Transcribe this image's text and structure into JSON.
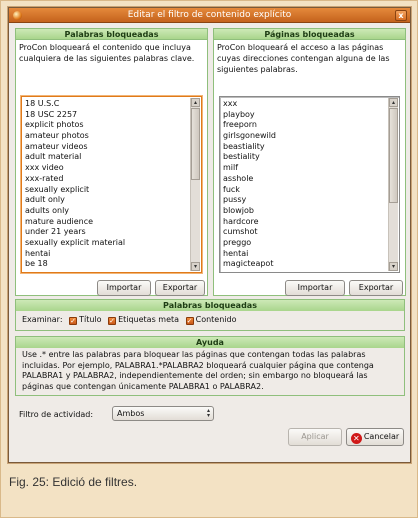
{
  "window": {
    "title": "Editar el filtro de contenido explícito",
    "close_glyph": "x"
  },
  "left_panel": {
    "header": "Palabras bloqueadas",
    "description": "ProCon bloqueará el contenido que incluya cualquiera de las siguientes palabras clave.",
    "items": [
      "18 U.S.C",
      "18 USC 2257",
      "explicit photos",
      "amateur photos",
      "amateur videos",
      "adult material",
      "xxx video",
      "xxx-rated",
      "sexually explicit",
      "adult only",
      "adults only",
      "mature audience",
      "under 21 years",
      "sexually explicit material",
      "hentai",
      "be 18"
    ],
    "import_label": "Importar",
    "export_label": "Exportar"
  },
  "right_panel": {
    "header": "Páginas bloqueadas",
    "description": "ProCon bloqueará el acceso a las páginas cuyas direcciones contengan alguna de las siguientes palabras.",
    "items": [
      "xxx",
      "playboy",
      "freeporn",
      "girlsgonewild",
      "beastiality",
      "bestiality",
      "milf",
      "asshole",
      "fuck",
      "pussy",
      "blowjob",
      "hardcore",
      "cumshot",
      "preggo",
      "hentai",
      "magicteapot"
    ],
    "import_label": "Importar",
    "export_label": "Exportar"
  },
  "blocked_words_section": {
    "header": "Palabras bloqueadas",
    "examine_label": "Examinar:",
    "options": [
      "Título",
      "Etiquetas meta",
      "Contenido"
    ]
  },
  "help": {
    "header": "Ayuda",
    "text": "Use .* entre las palabras para bloquear las páginas que contengan todas las palabras incluidas. Por ejemplo, PALABRA1.*PALABRA2 bloqueará cualquier página que contenga PALABRA1 y PALABRA2, independientemente del orden; sin embargo no bloqueará las páginas que contengan únicamente PALABRA1 o PALABRA2."
  },
  "activity_filter": {
    "label": "Filtro de actividad:",
    "value": "Ambos"
  },
  "buttons": {
    "apply": "Aplicar",
    "cancel": "Cancelar"
  },
  "caption": "Fig. 25: Edició de filtres."
}
